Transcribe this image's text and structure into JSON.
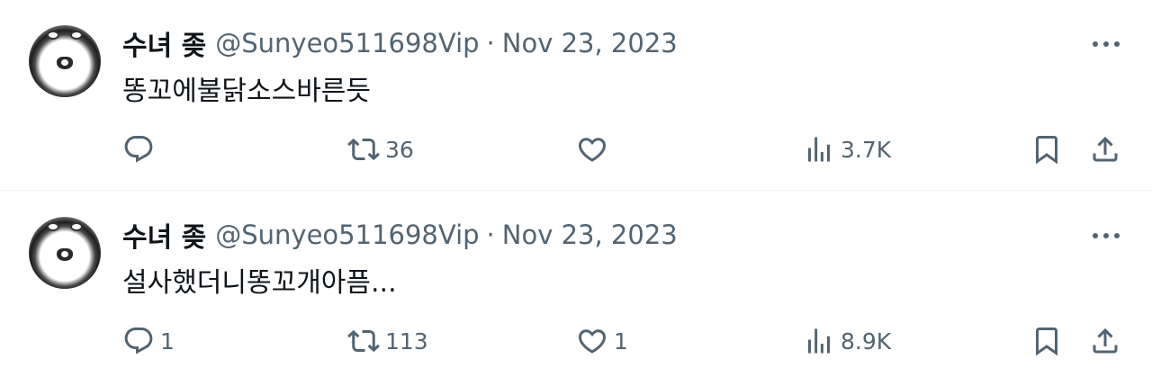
{
  "tweets": [
    {
      "author_name": "수녀 좆",
      "handle": "@Sunyeo511698Vip",
      "separator": "·",
      "date": "Nov 23, 2023",
      "text": "똥꼬에불닭소스바른듯",
      "stats": {
        "replies": "",
        "retweets": "36",
        "likes": "",
        "views": "3.7K"
      }
    },
    {
      "author_name": "수녀 좆",
      "handle": "@Sunyeo511698Vip",
      "separator": "·",
      "date": "Nov 23, 2023",
      "text": "설사했더니똥꼬개아픔...",
      "stats": {
        "replies": "1",
        "retweets": "113",
        "likes": "1",
        "views": "8.9K"
      }
    }
  ],
  "colors": {
    "text": "#0f1419",
    "secondary": "#536471",
    "divider": "#eff3f4"
  },
  "icons": [
    "reply-icon",
    "retweet-icon",
    "like-icon",
    "views-icon",
    "bookmark-icon",
    "share-icon",
    "more-icon"
  ]
}
